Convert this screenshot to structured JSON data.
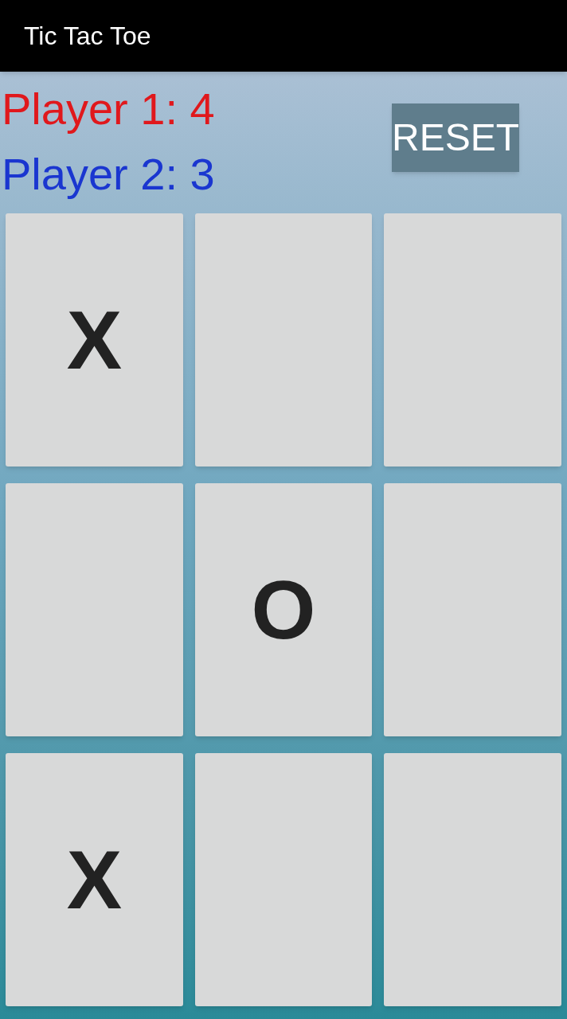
{
  "app_bar": {
    "title": "Tic Tac Toe"
  },
  "scores": [
    {
      "label": "Player 1: 4",
      "color": "#e0181c"
    },
    {
      "label": "Player 2: 3",
      "color": "#1a36d0"
    }
  ],
  "reset_button": {
    "label": "RESET"
  },
  "board": [
    {
      "kind": "marked",
      "mark": "X"
    },
    {
      "kind": "empty"
    },
    {
      "kind": "empty"
    },
    {
      "kind": "empty"
    },
    {
      "kind": "marked",
      "mark": "O"
    },
    {
      "kind": "empty"
    },
    {
      "kind": "marked",
      "mark": "X"
    },
    {
      "kind": "empty"
    },
    {
      "kind": "empty"
    }
  ]
}
